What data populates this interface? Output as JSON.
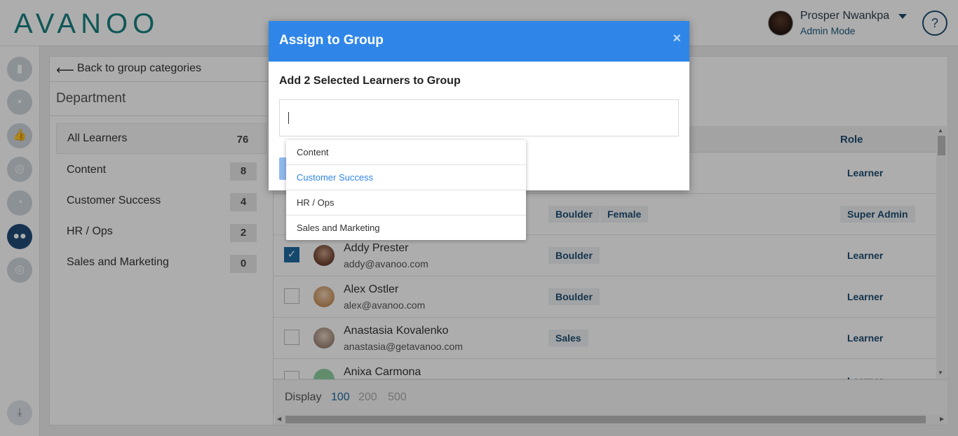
{
  "app": {
    "logo": "AVANOO"
  },
  "user": {
    "name": "Prosper Nwankpa",
    "mode": "Admin Mode",
    "help": "?"
  },
  "nav": {
    "back": "Back to group categories",
    "category": "Department"
  },
  "groups": [
    {
      "label": "All Learners",
      "count": "76"
    },
    {
      "label": "Content",
      "count": "8"
    },
    {
      "label": "Customer Success",
      "count": "4"
    },
    {
      "label": "HR / Ops",
      "count": "2"
    },
    {
      "label": "Sales and Marketing",
      "count": "0"
    }
  ],
  "table": {
    "role_header": "Role",
    "rows": [
      {
        "name": "",
        "email": "",
        "tags": [],
        "role": "Learner"
      },
      {
        "name": "",
        "email": "",
        "tags": [
          "Boulder",
          "Female"
        ],
        "role": "Super Admin"
      },
      {
        "name": "Addy Prester",
        "email": "addy@avanoo.com",
        "tags": [
          "Boulder"
        ],
        "role": "Learner",
        "checked": true
      },
      {
        "name": "Alex Ostler",
        "email": "alex@avanoo.com",
        "tags": [
          "Boulder"
        ],
        "role": "Learner"
      },
      {
        "name": "Anastasia Kovalenko",
        "email": "anastasia@getavanoo.com",
        "tags": [
          "Sales"
        ],
        "role": "Learner"
      },
      {
        "name": "Anixa Carmona",
        "email": "",
        "tags": [],
        "role": "Learner"
      }
    ]
  },
  "footer": {
    "display_label": "Display",
    "options": [
      "100",
      "200",
      "500"
    ],
    "selected": "100"
  },
  "modal": {
    "title": "Assign to Group",
    "close": "×",
    "subtitle": "Add 2 Selected Learners to Group",
    "input_value": "",
    "options": [
      "Content",
      "Customer Success",
      "HR / Ops",
      "Sales and Marketing"
    ],
    "highlighted": "Customer Success"
  },
  "colors": {
    "brand": "#19807f",
    "modal_header": "#2f86e8",
    "nav_active": "#1f4c78"
  },
  "icons": {
    "rail": [
      "bar-chart-icon",
      "chat-icon",
      "thumbs-up-icon",
      "target-icon",
      "pie-chart-icon",
      "users-icon",
      "target-icon"
    ],
    "download": "download-icon"
  }
}
